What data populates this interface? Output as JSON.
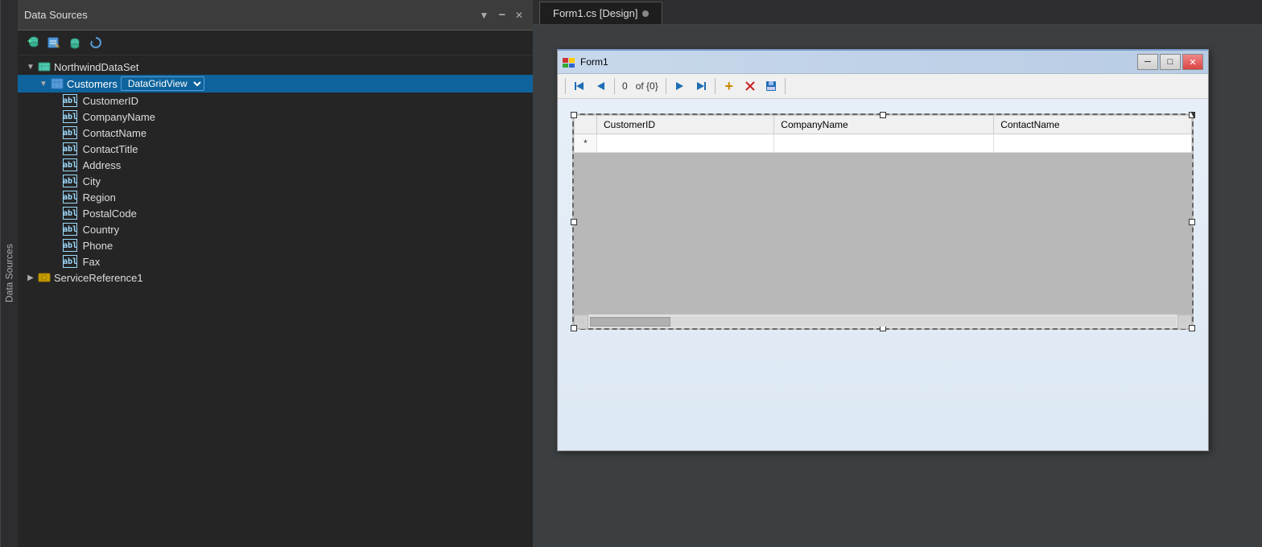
{
  "sidebar_tab": {
    "label": "Data Sources"
  },
  "panel": {
    "title": "Data Sources",
    "toolbar": {
      "add_datasource_tooltip": "Add New Data Source",
      "configure_tooltip": "Configure Data Source",
      "refresh_tooltip": "Refresh",
      "edit_tooltip": "Edit DataSet"
    }
  },
  "tree": {
    "dataset_label": "NorthwindDataSet",
    "customers_label": "Customers",
    "customers_dropdown_label": "▾",
    "fields": [
      "CustomerID",
      "CompanyName",
      "ContactName",
      "ContactTitle",
      "Address",
      "City",
      "Region",
      "PostalCode",
      "Country",
      "Phone",
      "Fax"
    ],
    "service_ref_label": "ServiceReference1"
  },
  "design": {
    "tab_label": "Form1.cs [Design]",
    "tab_dot": "●"
  },
  "form": {
    "title": "Form1",
    "icon": "🔴🟡",
    "nav": {
      "first_btn": "◀◀",
      "prev_btn": "◀",
      "count_value": "0",
      "count_of": "of {0}",
      "next_btn": "▶",
      "last_btn": "▶▶",
      "add_btn": "+",
      "delete_btn": "✕",
      "save_btn": "💾"
    },
    "grid": {
      "columns": [
        {
          "label": ""
        },
        {
          "label": "CustomerID"
        },
        {
          "label": "CompanyName"
        },
        {
          "label": "ContactName"
        }
      ],
      "new_row_marker": "*"
    }
  },
  "colors": {
    "bg_dark": "#2d2d30",
    "bg_panel": "#252526",
    "accent_blue": "#0e639c",
    "selection_blue": "#569cd6"
  }
}
